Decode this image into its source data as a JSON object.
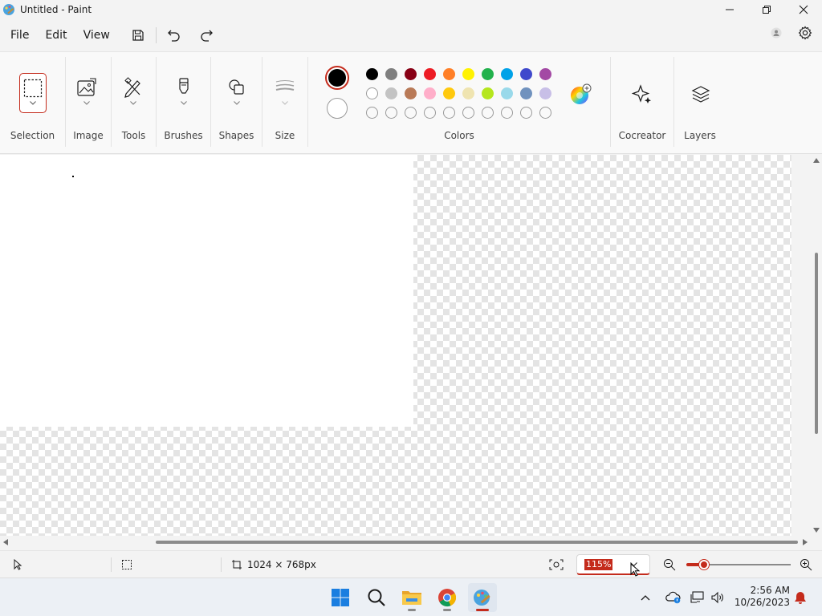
{
  "window": {
    "title": "Untitled - Paint"
  },
  "menu": {
    "items": [
      "File",
      "Edit",
      "View"
    ]
  },
  "ribbon": {
    "groups": {
      "selection": "Selection",
      "image": "Image",
      "tools": "Tools",
      "brushes": "Brushes",
      "shapes": "Shapes",
      "size": "Size",
      "colors": "Colors",
      "cocreator": "Cocreator",
      "layers": "Layers"
    },
    "colors": {
      "primary": "#000000",
      "secondary": "#ffffff",
      "row1": [
        "#000000",
        "#7f7f7f",
        "#880015",
        "#ed1c24",
        "#ff7f27",
        "#fff200",
        "#22b14c",
        "#00a2e8",
        "#3f48cc",
        "#a349a4"
      ],
      "row2": [
        "#ffffff",
        "#c3c3c3",
        "#b97a57",
        "#ffaec9",
        "#ffc90e",
        "#efe4b0",
        "#b5e61d",
        "#99d9ea",
        "#7092be",
        "#c8bfe7"
      ],
      "row3_empty_count": 10
    }
  },
  "status": {
    "canvas_size": "1024 × 768px",
    "zoom": "115%",
    "zoom_level_percent": 115
  },
  "taskbar": {
    "time": "2:56 AM",
    "date": "10/26/2023"
  }
}
